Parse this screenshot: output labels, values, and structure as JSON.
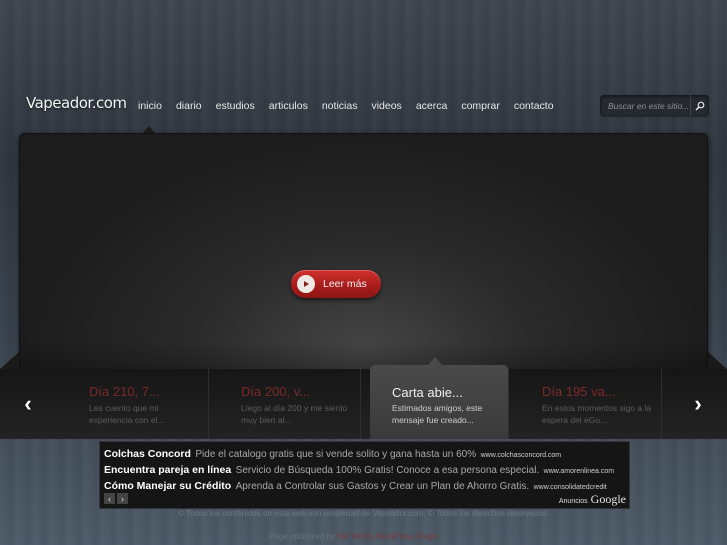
{
  "logo": "Vapeador.com",
  "nav": [
    "inicio",
    "diario",
    "estudios",
    "articulos",
    "noticias",
    "videos",
    "acerca",
    "comprar",
    "contacto"
  ],
  "search": {
    "placeholder": "Buscar en este sitio..."
  },
  "hero": {
    "button_label": "Leer más"
  },
  "slider": {
    "slides": [
      {
        "title": "Día 210, 7...",
        "desc": "Les cuento que mi experiencia con el..."
      },
      {
        "title": "Día 200, v...",
        "desc": "Llego al día 200 y me siento muy bien al..."
      },
      {
        "title": "Carta abie...",
        "desc": "Estimados amigos, este mensaje fue creado..."
      },
      {
        "title": "Día 195 va...",
        "desc": "En estos momentos sigo a la espera del eGo..."
      }
    ],
    "prev": "‹",
    "next": "›"
  },
  "ads": {
    "rows": [
      {
        "headline": "Colchas Concord",
        "body": "Pide el catalogo gratis que si vende solito y gana hasta un 60%",
        "url": "www.colchasconcord.com"
      },
      {
        "headline": "Encuentra pareja en línea",
        "body": "Servicio de Búsqueda 100% Gratis! Conoce a esa persona especial.",
        "url": "www.amorenlinea.com"
      },
      {
        "headline": "Cómo Manejar su Crédito",
        "body": "Aprenda a Controlar sus Gastos y Crear un Plan de Ahorro Gratis.",
        "url": "www.consolidatedcredit"
      }
    ],
    "ads_by": "Anuncios",
    "google": "Google"
  },
  "footer": {
    "copyright": "© Todos los contenidos de esta web son propiedad de Vapeador.com. © Todos los derechos reservados.",
    "optimized_prefix": "Page optimized by",
    "optimized_link": "WP Minify WordPress Plugin"
  }
}
